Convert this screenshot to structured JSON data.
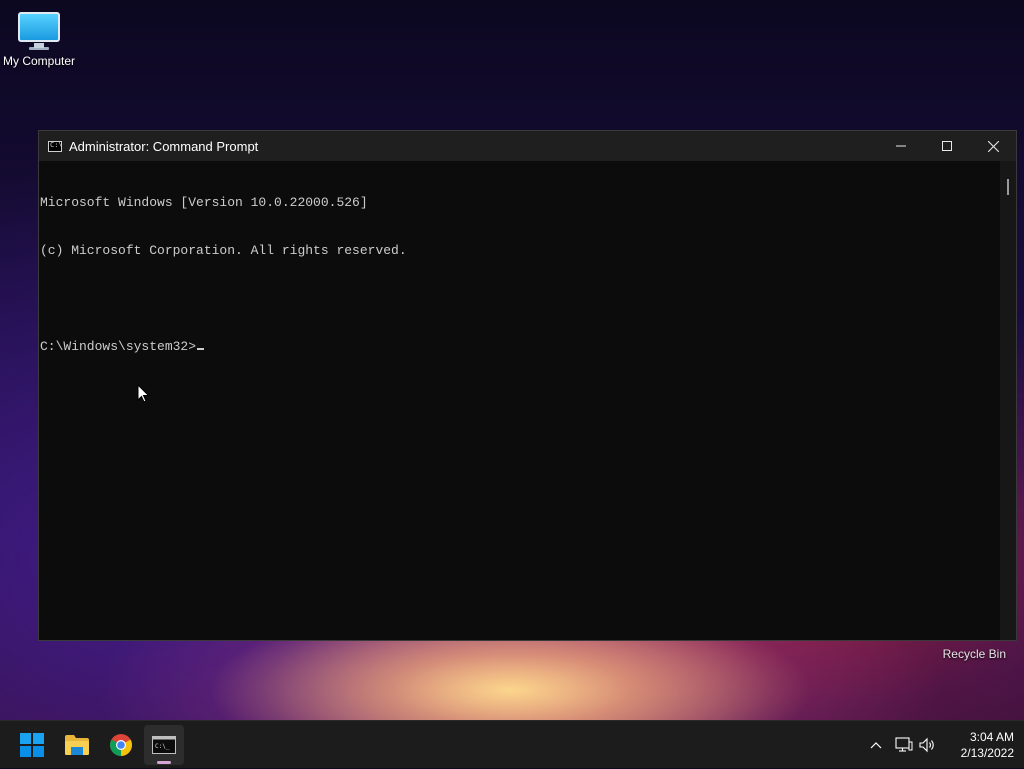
{
  "desktop": {
    "my_computer_label": "My Computer",
    "recycle_bin_label": "Recycle Bin"
  },
  "window": {
    "title": "Administrator: Command Prompt",
    "title_icon_text": "C:\\",
    "console_lines": [
      "Microsoft Windows [Version 10.0.22000.526]",
      "(c) Microsoft Corporation. All rights reserved.",
      "",
      "C:\\Windows\\system32>"
    ]
  },
  "taskbar": {
    "apps": [
      "start-icon",
      "file-explorer-icon",
      "chrome-icon",
      "command-prompt-icon"
    ],
    "active_app": "Command Prompt",
    "tray_icons": [
      "chevron-up-icon",
      "network-icon",
      "volume-icon"
    ],
    "clock_time": "3:04 AM",
    "clock_date": "2/13/2022"
  },
  "colors": {
    "console_bg": "#0c0c0c",
    "console_text": "#cccccc",
    "titlebar_bg": "#1f1f1f",
    "taskbar_bg": "#1c1c1c",
    "windows_blue": "#0a8fe8"
  }
}
